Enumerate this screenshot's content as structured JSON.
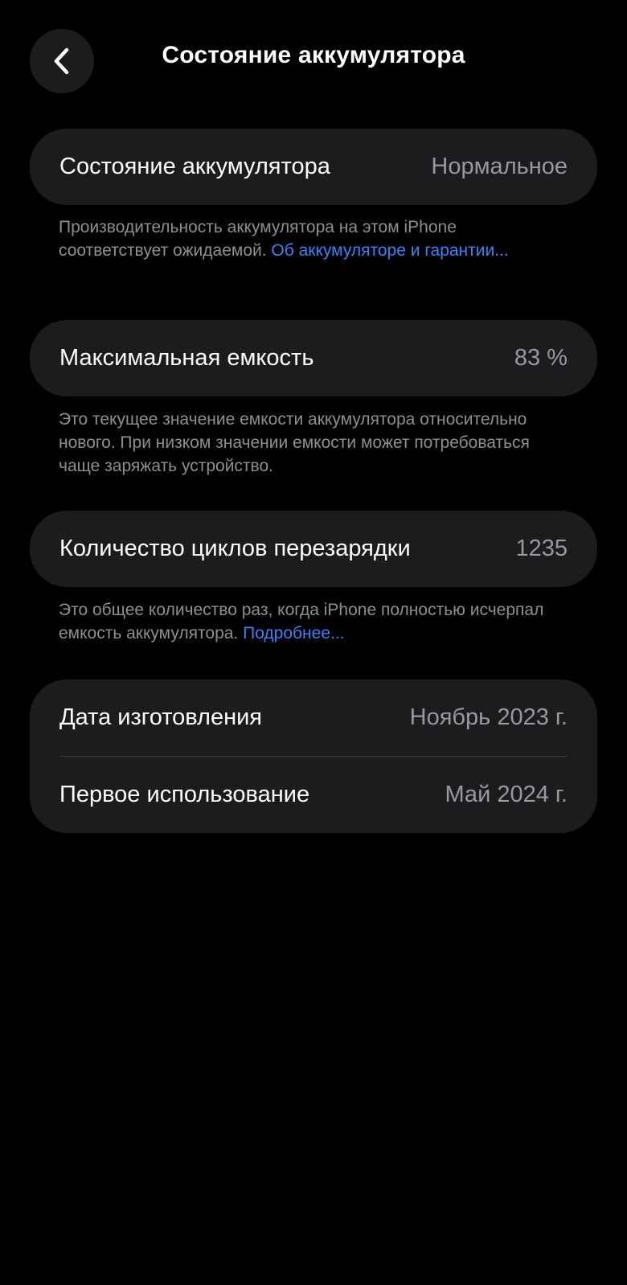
{
  "nav": {
    "title": "Состояние аккумулятора",
    "back_icon": "chevron-left-icon"
  },
  "battery_condition": {
    "label": "Состояние аккумулятора",
    "value": "Нормальное",
    "note_text": "Производительность аккумулятора на этом iPhone соответствует ожидаемой. ",
    "note_link": "Об аккумуляторе и гарантии..."
  },
  "max_capacity": {
    "label": "Максимальная емкость",
    "value": "83 %",
    "note_text": "Это текущее значение емкости аккумулятора относительно нового. При низком значении емкости может потребоваться чаще заряжать устройство."
  },
  "cycle_count": {
    "label": "Количество циклов перезарядки",
    "value": "1235",
    "note_text": "Это общее количество раз, когда iPhone полностью исчерпал емкость аккумулятора. ",
    "note_link": "Подробнее..."
  },
  "dates": {
    "manufacture_label": "Дата изготовления",
    "manufacture_value": "Ноябрь 2023 г.",
    "first_use_label": "Первое использование",
    "first_use_value": "Май 2024 г."
  },
  "colors": {
    "background": "#000000",
    "card": "#1c1c1e",
    "secondary_text": "#98989d",
    "link": "#3a82f7"
  }
}
